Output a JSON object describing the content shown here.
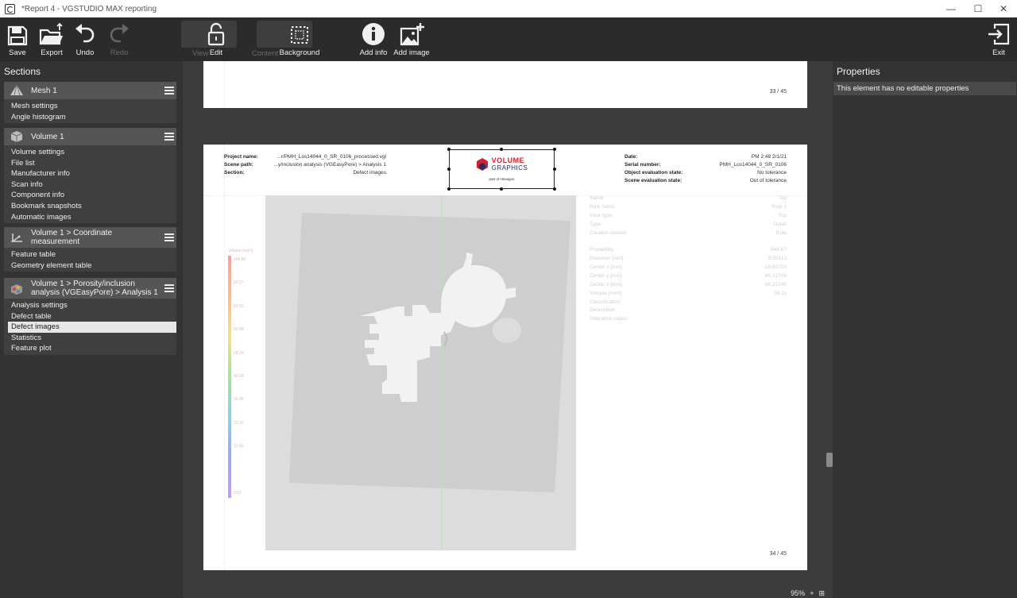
{
  "window": {
    "title": "*Report 4 - VGSTUDIO MAX reporting",
    "controls": [
      "—",
      "☐",
      "✕"
    ]
  },
  "toolbar": {
    "save": "Save",
    "export": "Export",
    "undo": "Undo",
    "redo": "Redo",
    "view_dim": "View",
    "edit": "Edit",
    "content_dim": "Content",
    "background": "Background",
    "add_info": "Add info",
    "add_image": "Add image",
    "exit": "Exit"
  },
  "sidebar": {
    "title": "Sections",
    "groups": [
      {
        "title": "Mesh 1",
        "icon": "mesh-pyramid-icon",
        "items": [
          "Mesh settings",
          "Angle histogram"
        ]
      },
      {
        "title": "Volume 1",
        "icon": "volume-icon",
        "items": [
          "Volume settings",
          "File list",
          "Manufacturer info",
          "Scan info",
          "Component info",
          "Bookmark snapshots",
          "Automatic images"
        ]
      },
      {
        "title": "Volume 1 > Coordinate measurement",
        "icon": "coordinate-measurement-icon",
        "items": [
          "Feature table",
          "Geometry element table"
        ]
      },
      {
        "title": "Volume 1 > Porosity/inclusion analysis (VGEasyPore) > Analysis 1",
        "icon": "porosity-analysis-icon",
        "items": [
          "Analysis settings",
          "Defect table",
          "Defect images",
          "Statistics",
          "Feature plot"
        ],
        "selected": "Defect images"
      }
    ]
  },
  "page_prev": {
    "number": "33 / 45"
  },
  "page": {
    "number": "34 / 45",
    "header_left": [
      {
        "label": "Project name:",
        "value": "...r/PMH_Los14044_0_SR_0106_processed.vgl"
      },
      {
        "label": "Scene path:",
        "value": "...y/inclusion analysis (VGEasyPore) > Analysis 1"
      },
      {
        "label": "Section:",
        "value": "Defect images"
      }
    ],
    "logo": {
      "line1": "VOLUME",
      "line2": "GRAPHICS",
      "tagline": "part of Hexagon",
      "colors": {
        "red": "#d3202f",
        "navy": "#1f2d6b"
      }
    },
    "header_right": [
      {
        "label": "Date:",
        "value": "PM 2:48 2/1/21"
      },
      {
        "label": "Serial number:",
        "value": "PMH_Los14044_0_SR_0106"
      },
      {
        "label": "Object evaluation state:",
        "value": "No tolerance"
      },
      {
        "label": "Scene evaluation state:",
        "value": "Out of tolerance"
      }
    ],
    "scale": {
      "title": "Volume [mm³]",
      "ticks": [
        "104.82",
        "93.17",
        "81.53",
        "69.89",
        "58.24",
        "46.60",
        "34.95",
        "23.31",
        "11.66",
        "0.02"
      ]
    },
    "properties": [
      {
        "label": "Name",
        "value": "Top"
      },
      {
        "label": "Rule name",
        "value": "Rule 1"
      },
      {
        "label": "View type",
        "value": "Top"
      },
      {
        "label": "Type",
        "value": "Detail"
      },
      {
        "label": "Creation reason",
        "value": "Rule"
      },
      {
        "label": "Probability",
        "value": "846.67"
      },
      {
        "label": "Diameter [mm]",
        "value": "8.50113"
      },
      {
        "label": "Center x [mm]",
        "value": "-19.63791"
      },
      {
        "label": "Center y [mm]",
        "value": "80.22709"
      },
      {
        "label": "Center z [mm]",
        "value": "-98.21245"
      },
      {
        "label": "Volume [mm³]",
        "value": "58.11"
      },
      {
        "label": "Classification",
        "value": ""
      },
      {
        "label": "Description",
        "value": ""
      },
      {
        "label": "Tolerance status",
        "value": ""
      }
    ]
  },
  "zoom": {
    "level": "95%",
    "plus": "+",
    "fit": "⊞"
  },
  "properties_panel": {
    "title": "Properties",
    "message": "This element has no editable properties"
  }
}
